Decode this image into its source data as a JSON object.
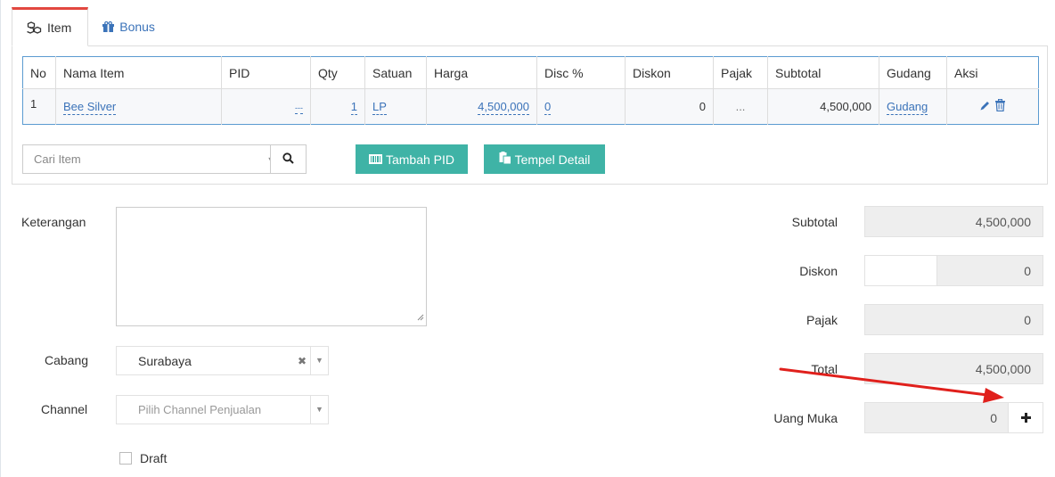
{
  "tabs": [
    {
      "label": "Item",
      "icon": "cubes-icon",
      "active": true
    },
    {
      "label": "Bonus",
      "icon": "gift-icon",
      "active": false
    }
  ],
  "table": {
    "headers": [
      "No",
      "Nama Item",
      "PID",
      "Qty",
      "Satuan",
      "Harga",
      "Disc %",
      "Diskon",
      "Pajak",
      "Subtotal",
      "Gudang",
      "Aksi"
    ],
    "rows": [
      {
        "no": "1",
        "nama_item": "Bee Silver",
        "pid": "---",
        "qty": "1",
        "satuan": "LP",
        "harga": "4,500,000",
        "disc_pct": "0",
        "diskon": "0",
        "pajak": "...",
        "subtotal": "4,500,000",
        "gudang": "Gudang"
      }
    ]
  },
  "search": {
    "placeholder": "Cari Item"
  },
  "buttons": {
    "tambah_pid": "Tambah PID",
    "tempel_detail": "Tempel Detail"
  },
  "form": {
    "keterangan_label": "Keterangan",
    "cabang_label": "Cabang",
    "cabang_value": "Surabaya",
    "channel_label": "Channel",
    "channel_placeholder": "Pilih Channel Penjualan",
    "draft_label": "Draft"
  },
  "summary": {
    "subtotal_label": "Subtotal",
    "subtotal_value": "4,500,000",
    "diskon_label": "Diskon",
    "diskon_value": "0",
    "pajak_label": "Pajak",
    "pajak_value": "0",
    "total_label": "Total",
    "total_value": "4,500,000",
    "uang_muka_label": "Uang Muka",
    "uang_muka_value": "0"
  },
  "colors": {
    "accent_teal": "#3fb3a6",
    "link_blue": "#3b73b9",
    "active_tab_red": "#e2473f",
    "annotation_arrow": "#e0201c"
  }
}
